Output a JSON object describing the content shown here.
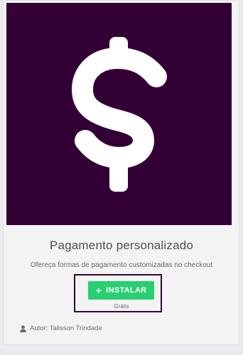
{
  "plugin": {
    "icon": "dollar-sign-icon",
    "hero_color": "#330036",
    "title": "Pagamento personalizado",
    "description": "Ofereça formas de pagamento customizadas no checkout",
    "install_label": "INSTALAR",
    "install_icon": "plus-icon",
    "install_color": "#27cf70",
    "price": "Grátis",
    "author_icon": "user-icon",
    "author": "Autor: Talisson Trindade"
  }
}
